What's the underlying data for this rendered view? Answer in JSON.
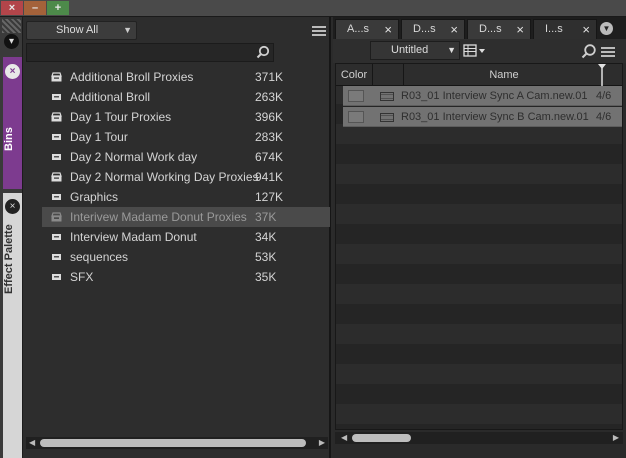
{
  "window": {
    "close_glyph": "×",
    "minimize_glyph": "–",
    "maximize_glyph": "+"
  },
  "side_tabs": {
    "bins_label": "Bins",
    "effect_palette_label": "Effect Palette",
    "close_glyph": "×",
    "collapse_glyph": "▾"
  },
  "bins_panel": {
    "filter_value": "Show All",
    "search_value": "",
    "items": [
      {
        "name": "Additional Broll Proxies",
        "size": "371K",
        "icon": "bin-proxy-icon",
        "selected": false
      },
      {
        "name": "Additional Broll",
        "size": "263K",
        "icon": "bin-icon",
        "selected": false
      },
      {
        "name": "Day 1 Tour Proxies",
        "size": "396K",
        "icon": "bin-proxy-icon",
        "selected": false
      },
      {
        "name": "Day 1 Tour",
        "size": "283K",
        "icon": "bin-icon",
        "selected": false
      },
      {
        "name": "Day 2 Normal Work day",
        "size": "674K",
        "icon": "bin-icon",
        "selected": false
      },
      {
        "name": "Day 2 Normal Working Day Proxies",
        "size": "941K",
        "icon": "bin-proxy-icon",
        "selected": false
      },
      {
        "name": "Graphics",
        "size": "127K",
        "icon": "bin-icon",
        "selected": false
      },
      {
        "name": "Interivew Madame Donut Proxies",
        "size": "37K",
        "icon": "bin-proxy-icon",
        "selected": true
      },
      {
        "name": "Interview Madam Donut",
        "size": "34K",
        "icon": "bin-icon",
        "selected": false
      },
      {
        "name": "sequences",
        "size": "53K",
        "icon": "bin-icon",
        "selected": false
      },
      {
        "name": "SFX",
        "size": "35K",
        "icon": "bin-icon",
        "selected": false
      }
    ]
  },
  "bin_tabs": [
    {
      "label": "A...s",
      "active": false
    },
    {
      "label": "D...s",
      "active": false
    },
    {
      "label": "D...s",
      "active": false
    },
    {
      "label": "I...s",
      "active": true
    }
  ],
  "bin_view": {
    "view_name": "Untitled",
    "columns": [
      "Color",
      "",
      "Name"
    ],
    "clips": [
      {
        "name": "R03_01 Interview Sync A Cam.new.01",
        "date": "4/6"
      },
      {
        "name": "R03_01 Interview Sync B Cam.new.01",
        "date": "4/6"
      }
    ]
  },
  "colors": {
    "bins_tab": "#7d3b8f",
    "selected_row": "#4a4a4a",
    "clip_row": "#727272"
  }
}
